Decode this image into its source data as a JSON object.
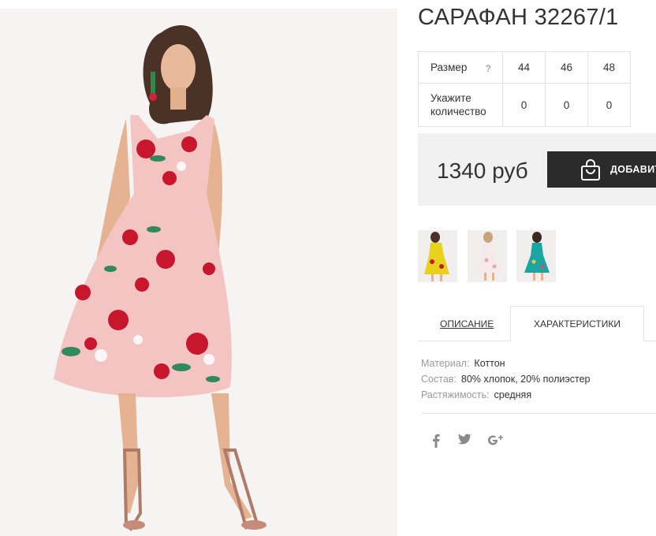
{
  "product": {
    "title": "САРАФАН 32267/1"
  },
  "sizes": {
    "size_label": "Размер",
    "help_mark": "?",
    "values": [
      "44",
      "46",
      "48"
    ],
    "qty_label_line1": "Укажите",
    "qty_label_line2": "количество",
    "quantities": [
      "0",
      "0",
      "0"
    ]
  },
  "purchase": {
    "price": "1340 руб",
    "add_button_label": "ДОБАВИТЬ",
    "button_color": "#2b2b2b"
  },
  "thumbnails": [
    {
      "name": "yellow-dress-thumbnail",
      "color": "#e8d21e"
    },
    {
      "name": "white-dress-thumbnail",
      "color": "#f2dede"
    },
    {
      "name": "teal-dress-thumbnail",
      "color": "#1aa6a0"
    }
  ],
  "tabs": {
    "description": "ОПИСАНИЕ",
    "characteristics": "ХАРАКТЕРИСТИКИ"
  },
  "specs": {
    "material_key": "Материал:",
    "material_val": "Коттон",
    "composition_key": "Состав:",
    "composition_val": "80% хлопок, 20% полиэстер",
    "stretch_key": "Растяжимость:",
    "stretch_val": "средняя"
  },
  "social": {
    "facebook": "facebook-icon",
    "twitter": "twitter-icon",
    "googleplus": "google-plus-icon"
  }
}
